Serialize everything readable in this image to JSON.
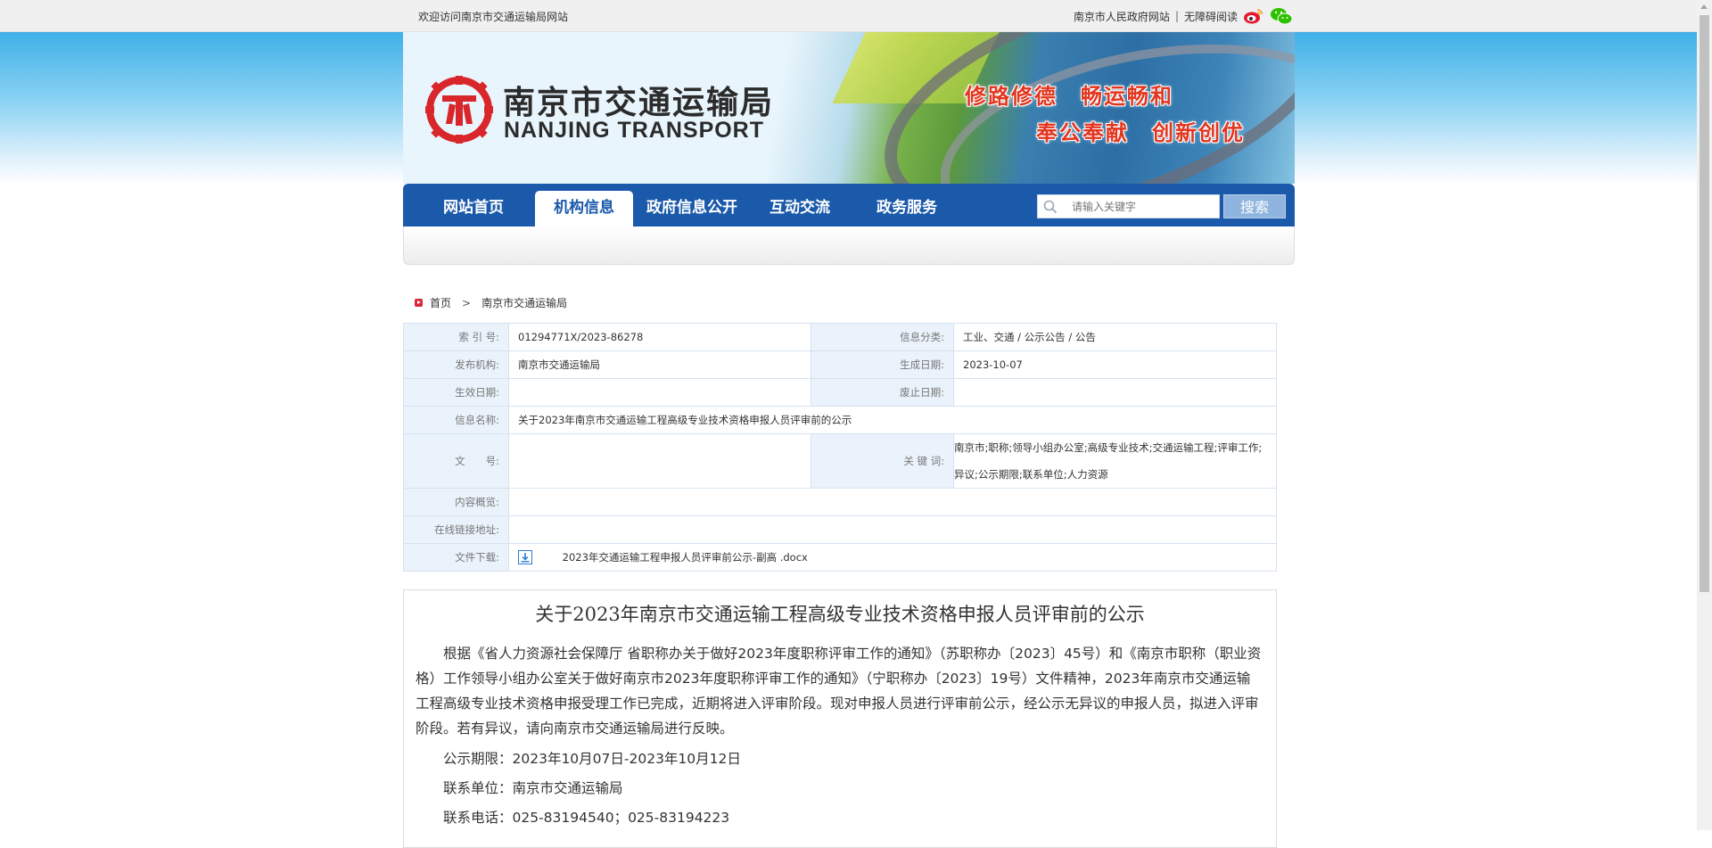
{
  "topbar": {
    "welcome": "欢迎访问南京市交通运输局网站",
    "gov_link": "南京市人民政府网站",
    "separator": "|",
    "accessible_link": "无障碍阅读",
    "weibo_icon": "weibo-icon",
    "wechat_icon": "wechat-icon"
  },
  "banner": {
    "title_cn": "南京市交通运输局",
    "title_en": "NANJING TRANSPORT",
    "slogan_line1": "修路修德　畅运畅和",
    "slogan_line2": "奉公奉献　创新创优"
  },
  "nav": {
    "items": [
      {
        "label": "网站首页",
        "active": false
      },
      {
        "label": "机构信息",
        "active": true
      },
      {
        "label": "政府信息公开",
        "active": false
      },
      {
        "label": "互动交流",
        "active": false
      },
      {
        "label": "政务服务",
        "active": false
      }
    ],
    "search_placeholder": "请输入关键字",
    "search_button": "搜索"
  },
  "breadcrumb": {
    "home": "首页",
    "sep": ">",
    "current": "南京市交通运输局"
  },
  "info": {
    "index_label": "索 引 号:",
    "index_value": "01294771X/2023-86278",
    "category_label": "信息分类:",
    "category_value": "工业、交通 / 公示公告 / 公告",
    "publisher_label": "发布机构:",
    "publisher_value": "南京市交通运输局",
    "created_label": "生成日期:",
    "created_value": "2023-10-07",
    "effective_label": "生效日期:",
    "effective_value": "",
    "expiry_label": "废止日期:",
    "expiry_value": "",
    "name_label": "信息名称:",
    "name_value": "关于2023年南京市交通运输工程高级专业技术资格申报人员评审前的公示",
    "docno_label": "文　　号:",
    "docno_value": "",
    "keywords_label": "关 键 词:",
    "keywords_value": "南京市;职称;领导小组办公室;高级专业技术;交通运输工程;评审工作;异议;公示期限;联系单位;人力资源",
    "overview_label": "内容概览:",
    "overview_value": "",
    "link_label": "在线链接地址:",
    "link_value": "",
    "download_label": "文件下载:",
    "download_value": "2023年交通运输工程申报人员评审前公示-副高 .docx"
  },
  "article": {
    "title": "关于2023年南京市交通运输工程高级专业技术资格申报人员评审前的公示",
    "paragraph": "根据《省人力资源社会保障厅 省职称办关于做好2023年度职称评审工作的通知》（苏职称办〔2023〕45号）和《南京市职称（职业资格）工作领导小组办公室关于做好南京市2023年度职称评审工作的通知》（宁职称办〔2023〕19号）文件精神，2023年南京市交通运输工程高级专业技术资格申报受理工作已完成，近期将进入评审阶段。现对申报人员进行评审前公示，经公示无异议的申报人员，拟进入评审阶段。若有异议，请向南京市交通运输局进行反映。",
    "period": "公示期限：2023年10月07日-2023年10月12日",
    "contact_unit": "联系单位：南京市交通运输局",
    "phone": "联系电话：025-83194540；025-83194223"
  },
  "colors": {
    "nav_blue": "#1b5aab",
    "slogan_red": "#e3361f",
    "label_bg": "#eaf2fb"
  }
}
